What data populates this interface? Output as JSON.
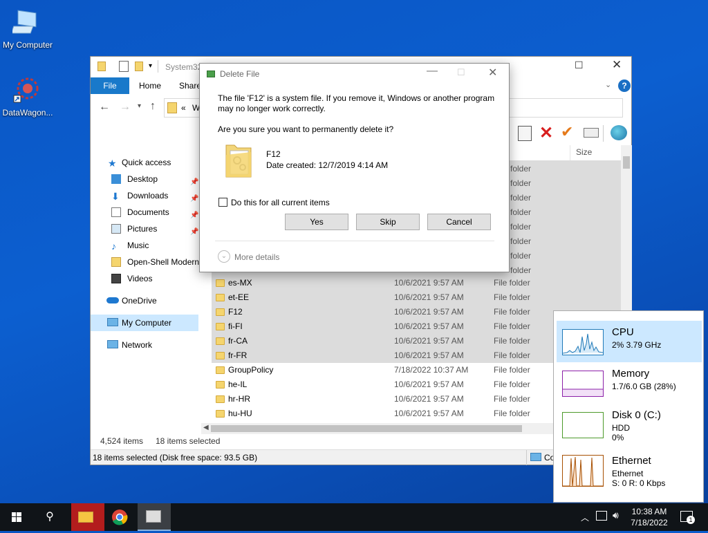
{
  "desktop": {
    "icons": [
      {
        "label": "My Computer"
      },
      {
        "label": "DataWagon..."
      }
    ]
  },
  "explorer": {
    "title": "System32",
    "ribbon_tabs": [
      "File",
      "Home",
      "Share"
    ],
    "address_prefix": "«",
    "address_text": "Wi",
    "column_size": "Size",
    "nav": [
      {
        "label": "Quick access"
      },
      {
        "label": "Desktop",
        "pinned": true
      },
      {
        "label": "Downloads",
        "pinned": true
      },
      {
        "label": "Documents",
        "pinned": true
      },
      {
        "label": "Pictures",
        "pinned": true
      },
      {
        "label": "Music"
      },
      {
        "label": "Open-Shell Modern"
      },
      {
        "label": "Videos"
      },
      {
        "label": "OneDrive"
      },
      {
        "label": "My Computer"
      },
      {
        "label": "Network"
      }
    ],
    "hidden_rows_type": [
      "folder",
      "folder",
      "folder",
      "folder",
      "folder",
      "folder",
      "folder",
      "folder"
    ],
    "rows": [
      {
        "name": "es-MX",
        "date": "10/6/2021 9:57 AM",
        "type": "File folder",
        "selected": true
      },
      {
        "name": "et-EE",
        "date": "10/6/2021 9:57 AM",
        "type": "File folder",
        "selected": true
      },
      {
        "name": "F12",
        "date": "10/6/2021 9:57 AM",
        "type": "File folder",
        "selected": true
      },
      {
        "name": "fi-FI",
        "date": "10/6/2021 9:57 AM",
        "type": "File folder",
        "selected": true
      },
      {
        "name": "fr-CA",
        "date": "10/6/2021 9:57 AM",
        "type": "File folder",
        "selected": true
      },
      {
        "name": "fr-FR",
        "date": "10/6/2021 9:57 AM",
        "type": "File folder",
        "selected": true
      },
      {
        "name": "GroupPolicy",
        "date": "7/18/2022 10:37 AM",
        "type": "File folder",
        "selected": false
      },
      {
        "name": "he-IL",
        "date": "10/6/2021 9:57 AM",
        "type": "File folder",
        "selected": false
      },
      {
        "name": "hr-HR",
        "date": "10/6/2021 9:57 AM",
        "type": "File folder",
        "selected": false
      },
      {
        "name": "hu-HU",
        "date": "10/6/2021 9:57 AM",
        "type": "File folder",
        "selected": false
      }
    ],
    "status_count": "4,524 items",
    "status_selected": "18 items selected",
    "details_bar": "18 items selected (Disk free space: 93.5 GB)",
    "details_bar_right": "Co"
  },
  "dialog": {
    "title": "Delete File",
    "message": "The file 'F12' is a system file. If you remove it, Windows or another program may no longer work correctly.",
    "question": "Are you sure you want to permanently delete it?",
    "file_name": "F12",
    "file_date": "Date created: 12/7/2019 4:14 AM",
    "checkbox_label": "Do this for all current items",
    "yes": "Yes",
    "skip": "Skip",
    "cancel": "Cancel",
    "more_details": "More details"
  },
  "taskmgr": {
    "items": [
      {
        "title": "CPU",
        "line1": "2%  3.79 GHz",
        "line2": "",
        "color": "#1f79b8"
      },
      {
        "title": "Memory",
        "line1": "1.7/6.0 GB (28%)",
        "line2": "",
        "color": "#8b1fa8"
      },
      {
        "title": "Disk 0 (C:)",
        "line1": "HDD",
        "line2": "0%",
        "color": "#4c9a2a"
      },
      {
        "title": "Ethernet",
        "line1": "Ethernet",
        "line2": "S: 0 R: 0 Kbps",
        "color": "#a74f01"
      }
    ]
  },
  "taskbar": {
    "time": "10:38 AM",
    "date": "7/18/2022",
    "notif_count": "1"
  }
}
